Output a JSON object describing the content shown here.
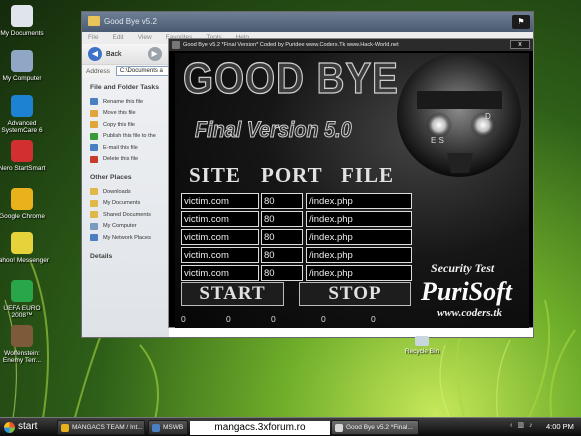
{
  "desktop": {
    "icons": [
      {
        "label": "My Documents",
        "icon": "my-documents-icon",
        "color": "#dfe5ea"
      },
      {
        "label": "My Computer",
        "icon": "my-computer-icon",
        "color": "#8fa7c4"
      },
      {
        "label": "Advanced SystemCare 6",
        "icon": "advanced-systemcare-icon",
        "color": "#1e82d2"
      },
      {
        "label": "Nero StartSmart",
        "icon": "nero-icon",
        "color": "#d23030"
      },
      {
        "label": "Google Chrome",
        "icon": "chrome-icon",
        "color": "#e9b21c"
      },
      {
        "label": "Yahoo! Messenger",
        "icon": "yahoo-messenger-icon",
        "color": "#e6d23a"
      },
      {
        "label": "UEFA EURO 2008™",
        "icon": "uefa-euro-icon",
        "color": "#2aa64a"
      },
      {
        "label": "Wolfenstein: Enemy Terr...",
        "icon": "wolfenstein-icon",
        "color": "#7c5a3a"
      }
    ],
    "recycle_bin": "Recycle Bin"
  },
  "explorer": {
    "title": "Good Bye v5.2",
    "menu": [
      "File",
      "Edit",
      "View",
      "Favorites",
      "Tools",
      "Help"
    ],
    "back_label": "Back",
    "address_label": "Address",
    "address_value": "C:\\Documents a",
    "file_tasks_heading": "File and Folder Tasks",
    "file_tasks": [
      {
        "label": "Rename this file",
        "color": "#4a7fc2"
      },
      {
        "label": "Move this file",
        "color": "#e0a63a"
      },
      {
        "label": "Copy this file",
        "color": "#e0a63a"
      },
      {
        "label": "Publish this file to the",
        "color": "#3a9a3a"
      },
      {
        "label": "E-mail this file",
        "color": "#4a7fc2"
      },
      {
        "label": "Delete this file",
        "color": "#c83a2a"
      }
    ],
    "other_places_heading": "Other Places",
    "other_places": [
      {
        "label": "Downloads",
        "color": "#e0b84a"
      },
      {
        "label": "My Documents",
        "color": "#e0b84a"
      },
      {
        "label": "Shared Documents",
        "color": "#e0b84a"
      },
      {
        "label": "My Computer",
        "color": "#7a9ac2"
      },
      {
        "label": "My Network Places",
        "color": "#4a7fc2"
      }
    ],
    "details_heading": "Details"
  },
  "app": {
    "title": "Good Bye v5.2 *Final Version* Coded by Puridee www.Coders.Tk  www.Hack-World.net",
    "close_label": "x",
    "logo_title": "GOOD BYE",
    "logo_subtitle": "Final Version 5.0",
    "headers": {
      "site": "SITE",
      "port": "PORT",
      "file": "FILE"
    },
    "rows": [
      {
        "site": "victim.com",
        "port": "80",
        "file": "/index.php"
      },
      {
        "site": "victim.com",
        "port": "80",
        "file": "/index.php"
      },
      {
        "site": "victim.com",
        "port": "80",
        "file": "/index.php"
      },
      {
        "site": "victim.com",
        "port": "80",
        "file": "/index.php"
      },
      {
        "site": "victim.com",
        "port": "80",
        "file": "/index.php"
      }
    ],
    "start_label": "START",
    "stop_label": "STOP",
    "counters": [
      "0",
      "0",
      "0",
      "0",
      "0"
    ],
    "brand_tagline": "Security Test",
    "brand_name": "PuriSoft",
    "brand_url": "www.coders.tk"
  },
  "taskbar": {
    "start_label": "start",
    "tasks": [
      {
        "label": "MANGACS TEAM / Int...",
        "color": "#e9b21c"
      },
      {
        "label": "MSWB",
        "color": "#4a7fc2"
      },
      {
        "label": "Good Bye v5.2 *Final...",
        "color": "#d8d8d8",
        "active": true
      }
    ],
    "watermark": "mangacs.3xforum.ro",
    "clock": "4:00 PM"
  }
}
